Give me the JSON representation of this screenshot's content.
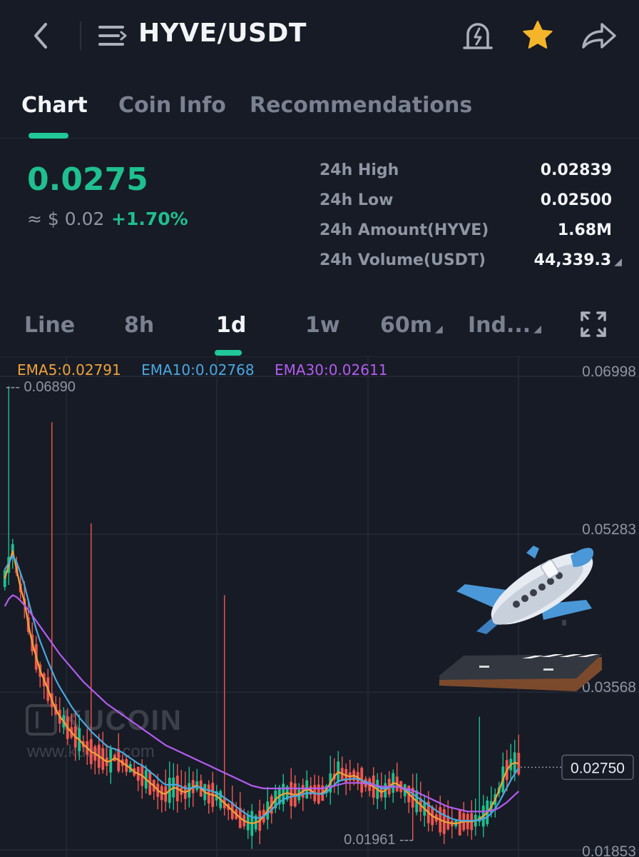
{
  "header": {
    "pair": "HYVE/USDT",
    "icons": {
      "back": "chevron-left-icon",
      "menu": "menu-icon",
      "alert": "price-alert-bell-icon",
      "favorite": "star-icon",
      "share": "share-arrow-icon"
    },
    "favorite_color": "#f5b52a"
  },
  "tabs": [
    {
      "label": "Chart",
      "active": true
    },
    {
      "label": "Coin Info",
      "active": false
    },
    {
      "label": "Recommendations",
      "active": false
    }
  ],
  "ticker": {
    "last_price": "0.0275",
    "fiat_price": "≈ $ 0.02",
    "change": "+1.70%",
    "up_color": "#1fbf8f"
  },
  "stats": [
    {
      "label": "24h High",
      "value": "0.02839"
    },
    {
      "label": "24h Low",
      "value": "0.02500"
    },
    {
      "label": "24h Amount(HYVE)",
      "value": "1.68M"
    },
    {
      "label": "24h Volume(USDT)",
      "value": "44,339.3"
    }
  ],
  "intervals": [
    {
      "label": "Line",
      "active": false,
      "dropdown": false
    },
    {
      "label": "8h",
      "active": false,
      "dropdown": false
    },
    {
      "label": "1d",
      "active": true,
      "dropdown": false
    },
    {
      "label": "1w",
      "active": false,
      "dropdown": false
    },
    {
      "label": "60m",
      "active": false,
      "dropdown": true
    },
    {
      "label": "Ind...",
      "active": false,
      "dropdown": true
    }
  ],
  "expand_icon": "fullscreen-expand-icon",
  "ema": {
    "ema5": {
      "label": "EMA5:0.02791",
      "color": "#f0a33a"
    },
    "ema10": {
      "label": "EMA10:0.02768",
      "color": "#4aa8e0"
    },
    "ema30": {
      "label": "EMA30:0.02611",
      "color": "#b45cf0"
    }
  },
  "watermark": {
    "logo": "KUCOIN",
    "url": "www.kucoin.com"
  },
  "sticker": "airplane-takeoff-sticker",
  "chart_data": {
    "type": "candlestick",
    "y_ticks": [
      "0.06998",
      "0.05283",
      "0.03568",
      "0.01853"
    ],
    "ylim": [
      0.01853,
      0.06998
    ],
    "max_marker": "0.06890",
    "min_marker": "0.01961",
    "last_price_label": "0.02750",
    "last_value": 0.0275,
    "up_color": "#1fbf8f",
    "down_color": "#f0574f",
    "series": [
      {
        "name": "EMA5:0.02791",
        "values": [
          0.048,
          0.0495,
          0.051,
          0.049,
          0.047,
          0.0455,
          0.043,
          0.041,
          0.0395,
          0.038,
          0.037,
          0.036,
          0.0348,
          0.0338,
          0.033,
          0.0325,
          0.0318,
          0.0313,
          0.0308,
          0.0305,
          0.03,
          0.0296,
          0.0292,
          0.029,
          0.0287,
          0.0284,
          0.0281,
          0.0282,
          0.0285,
          0.0283,
          0.028,
          0.0277,
          0.0274,
          0.027,
          0.0268,
          0.0266,
          0.0262,
          0.0258,
          0.0255,
          0.025,
          0.0247,
          0.0246,
          0.025,
          0.0253,
          0.0252,
          0.0249,
          0.0248,
          0.025,
          0.0254,
          0.0255,
          0.0252,
          0.0248,
          0.0246,
          0.0245,
          0.0244,
          0.024,
          0.0236,
          0.0232,
          0.0228,
          0.0224,
          0.022,
          0.0217,
          0.0215,
          0.0214,
          0.0215,
          0.0217,
          0.0222,
          0.0228,
          0.0234,
          0.024,
          0.0244,
          0.0246,
          0.0247,
          0.0246,
          0.0245,
          0.0246,
          0.0249,
          0.0251,
          0.025,
          0.0247,
          0.0246,
          0.0247,
          0.0251,
          0.0258,
          0.0265,
          0.027,
          0.0268,
          0.0266,
          0.0265,
          0.0266,
          0.0264,
          0.0261,
          0.0258,
          0.0256,
          0.0254,
          0.0251,
          0.0248,
          0.025,
          0.0254,
          0.0258,
          0.0257,
          0.0254,
          0.025,
          0.0246,
          0.0242,
          0.0238,
          0.0234,
          0.023,
          0.0226,
          0.0222,
          0.022,
          0.0218,
          0.0216,
          0.0215,
          0.0214,
          0.0214,
          0.0215,
          0.0216,
          0.0216,
          0.0216,
          0.0217,
          0.0219,
          0.0222,
          0.0226,
          0.0232,
          0.024,
          0.025,
          0.0262,
          0.0272,
          0.0278,
          0.028,
          0.0279
        ]
      },
      {
        "name": "EMA10:0.02768",
        "values": [
          0.049,
          0.0497,
          0.0505,
          0.0498,
          0.0486,
          0.0473,
          0.0456,
          0.044,
          0.0425,
          0.0412,
          0.0401,
          0.039,
          0.038,
          0.037,
          0.0362,
          0.0355,
          0.0348,
          0.0341,
          0.0335,
          0.0329,
          0.0324,
          0.0319,
          0.0314,
          0.031,
          0.0306,
          0.0302,
          0.0298,
          0.0296,
          0.0295,
          0.0293,
          0.0291,
          0.0288,
          0.0285,
          0.0282,
          0.0279,
          0.0277,
          0.0274,
          0.027,
          0.0267,
          0.0263,
          0.0259,
          0.0256,
          0.0256,
          0.0256,
          0.0256,
          0.0254,
          0.0252,
          0.0252,
          0.0253,
          0.0254,
          0.0253,
          0.0251,
          0.025,
          0.0249,
          0.0247,
          0.0245,
          0.0242,
          0.0239,
          0.0236,
          0.0232,
          0.0229,
          0.0226,
          0.0223,
          0.0221,
          0.022,
          0.022,
          0.0222,
          0.0225,
          0.0229,
          0.0233,
          0.0237,
          0.024,
          0.0242,
          0.0243,
          0.0244,
          0.0244,
          0.0246,
          0.0247,
          0.0247,
          0.0247,
          0.0246,
          0.0246,
          0.0248,
          0.0252,
          0.0256,
          0.026,
          0.0261,
          0.0262,
          0.0262,
          0.0263,
          0.0262,
          0.0261,
          0.0259,
          0.0258,
          0.0256,
          0.0254,
          0.0252,
          0.0252,
          0.0253,
          0.0254,
          0.0254,
          0.0253,
          0.0251,
          0.0249,
          0.0246,
          0.0243,
          0.024,
          0.0237,
          0.0234,
          0.0231,
          0.0228,
          0.0225,
          0.0223,
          0.0221,
          0.0219,
          0.0218,
          0.0217,
          0.0217,
          0.0217,
          0.0217,
          0.0217,
          0.0218,
          0.0219,
          0.0221,
          0.0225,
          0.023,
          0.0237,
          0.0245,
          0.0253,
          0.0261,
          0.0268,
          0.0274
        ]
      },
      {
        "name": "EMA30:0.02611",
        "values": [
          0.045,
          0.0458,
          0.0462,
          0.046,
          0.0456,
          0.0451,
          0.0446,
          0.044,
          0.0434,
          0.0428,
          0.0422,
          0.0416,
          0.041,
          0.0404,
          0.0398,
          0.0393,
          0.0388,
          0.0383,
          0.0378,
          0.0373,
          0.0368,
          0.0364,
          0.036,
          0.0356,
          0.0352,
          0.0348,
          0.0344,
          0.0341,
          0.0338,
          0.0335,
          0.0332,
          0.0329,
          0.0326,
          0.0323,
          0.032,
          0.0317,
          0.0314,
          0.0311,
          0.0308,
          0.0305,
          0.0302,
          0.0299,
          0.0297,
          0.0295,
          0.0293,
          0.0291,
          0.0289,
          0.0287,
          0.0285,
          0.0283,
          0.0281,
          0.0279,
          0.0277,
          0.0275,
          0.0273,
          0.0271,
          0.0269,
          0.0267,
          0.0265,
          0.0263,
          0.0261,
          0.0259,
          0.0257,
          0.0255,
          0.0254,
          0.0253,
          0.0252,
          0.0252,
          0.0252,
          0.0252,
          0.0252,
          0.0252,
          0.0252,
          0.0252,
          0.0252,
          0.0252,
          0.0252,
          0.0252,
          0.0252,
          0.0252,
          0.0252,
          0.0252,
          0.0253,
          0.0254,
          0.0255,
          0.0256,
          0.0257,
          0.0258,
          0.0258,
          0.0258,
          0.0258,
          0.0258,
          0.0257,
          0.0257,
          0.0256,
          0.0255,
          0.0254,
          0.0254,
          0.0254,
          0.0254,
          0.0254,
          0.0253,
          0.0252,
          0.0251,
          0.025,
          0.0248,
          0.0246,
          0.0244,
          0.0242,
          0.024,
          0.0238,
          0.0236,
          0.0234,
          0.0232,
          0.0231,
          0.023,
          0.0229,
          0.0228,
          0.0227,
          0.0227,
          0.0227,
          0.0227,
          0.0227,
          0.0227,
          0.0228,
          0.0229,
          0.0231,
          0.0234,
          0.0237,
          0.0241,
          0.0245,
          0.0249
        ]
      }
    ]
  }
}
